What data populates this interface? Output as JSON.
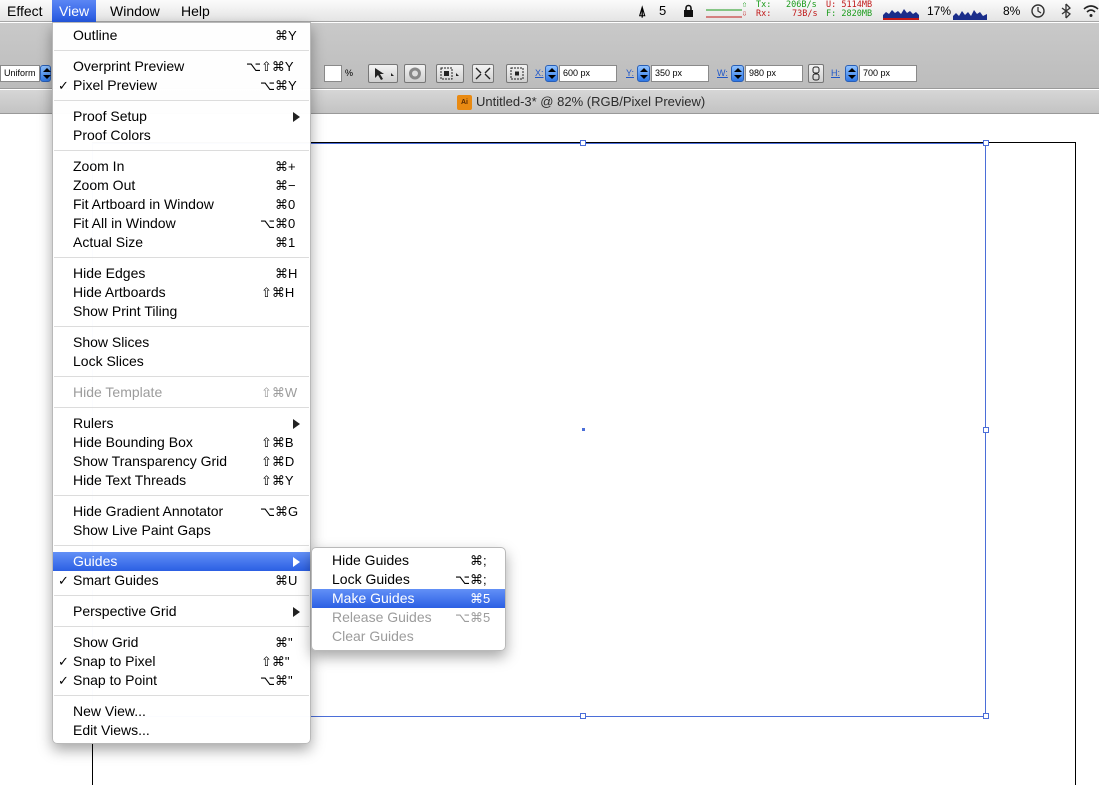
{
  "menubar": {
    "items": [
      "Effect",
      "View",
      "Window",
      "Help"
    ],
    "tray": {
      "adobe_badge": "5",
      "net_tx_label": "Tx:",
      "net_rx_label": "Rx:",
      "net_tx": "206B/s",
      "net_rx": "73B/s",
      "mem_used": "U: 5114MB",
      "mem_free": "F: 2820MB",
      "cpu1": "17%",
      "cpu2": "8%"
    }
  },
  "control_panel": {
    "stroke_profile": "Uniform",
    "pct_symbol": "%",
    "x_label": "X:",
    "x_value": "600 px",
    "y_label": "Y:",
    "y_value": "350 px",
    "w_label": "W:",
    "w_value": "980 px",
    "h_label": "H:",
    "h_value": "700 px"
  },
  "document": {
    "tab_title": "Untitled-3* @ 82% (RGB/Pixel Preview)",
    "app_icon_text": "Ai"
  },
  "view_menu": {
    "items": [
      {
        "label": "Outline",
        "shortcut": "⌘Y"
      },
      {
        "label": "Overprint Preview",
        "shortcut": "⌥⇧⌘Y"
      },
      {
        "label": "Pixel Preview",
        "shortcut": "⌥⌘Y",
        "checked": "✓"
      },
      {
        "label": "Proof Setup"
      },
      {
        "label": "Proof Colors"
      },
      {
        "label": "Zoom In",
        "shortcut": "⌘+"
      },
      {
        "label": "Zoom Out",
        "shortcut": "⌘−"
      },
      {
        "label": "Fit Artboard in Window",
        "shortcut": "⌘0"
      },
      {
        "label": "Fit All in Window",
        "shortcut": "⌥⌘0"
      },
      {
        "label": "Actual Size",
        "shortcut": "⌘1"
      },
      {
        "label": "Hide Edges",
        "shortcut": "⌘H"
      },
      {
        "label": "Hide Artboards",
        "shortcut": "⇧⌘H"
      },
      {
        "label": "Show Print Tiling"
      },
      {
        "label": "Show Slices"
      },
      {
        "label": "Lock Slices"
      },
      {
        "label": "Hide Template",
        "shortcut": "⇧⌘W"
      },
      {
        "label": "Rulers"
      },
      {
        "label": "Hide Bounding Box",
        "shortcut": "⇧⌘B"
      },
      {
        "label": "Show Transparency Grid",
        "shortcut": "⇧⌘D"
      },
      {
        "label": "Hide Text Threads",
        "shortcut": "⇧⌘Y"
      },
      {
        "label": "Hide Gradient Annotator",
        "shortcut": "⌥⌘G"
      },
      {
        "label": "Show Live Paint Gaps"
      },
      {
        "label": "Guides"
      },
      {
        "label": "Smart Guides",
        "shortcut": "⌘U",
        "checked": "✓"
      },
      {
        "label": "Perspective Grid"
      },
      {
        "label": "Show Grid",
        "shortcut": "⌘\""
      },
      {
        "label": "Snap to Pixel",
        "shortcut": "⇧⌘\"",
        "checked": "✓"
      },
      {
        "label": "Snap to Point",
        "shortcut": "⌥⌘\"",
        "checked": "✓"
      },
      {
        "label": "New View..."
      },
      {
        "label": "Edit Views..."
      }
    ]
  },
  "guides_submenu": {
    "items": [
      {
        "label": "Hide Guides",
        "shortcut": "⌘;"
      },
      {
        "label": "Lock Guides",
        "shortcut": "⌥⌘;"
      },
      {
        "label": "Make Guides",
        "shortcut": "⌘5"
      },
      {
        "label": "Release Guides",
        "shortcut": "⌥⌘5"
      },
      {
        "label": "Clear Guides"
      }
    ]
  }
}
